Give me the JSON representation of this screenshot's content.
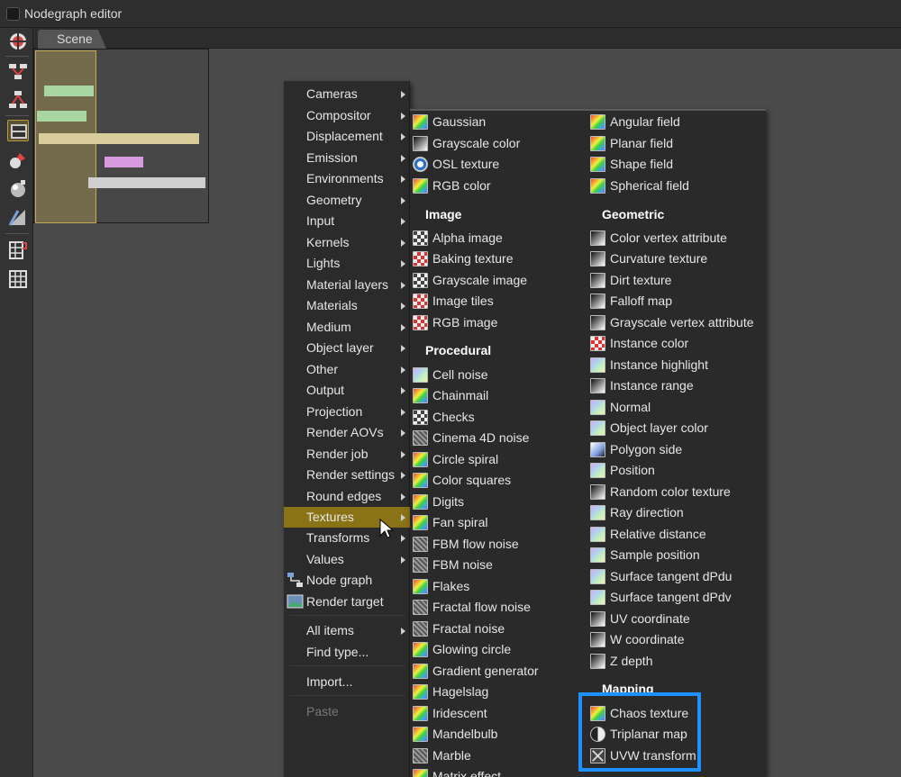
{
  "window": {
    "title": "Nodegraph editor"
  },
  "tabs": [
    {
      "label": "Scene"
    }
  ],
  "toolbar": {
    "tools": [
      {
        "icon": "scene-tool-icon"
      },
      {
        "icon": "nodes-up-icon"
      },
      {
        "icon": "nodes-down-icon"
      },
      {
        "icon": "image-tool-icon"
      },
      {
        "icon": "paint-tool-icon"
      },
      {
        "icon": "sphere-tool-icon"
      },
      {
        "icon": "texture-tool-icon"
      },
      {
        "icon": "grid-magnet-icon"
      },
      {
        "icon": "grid-icon"
      }
    ]
  },
  "context_menu": {
    "items": [
      {
        "label": "Cameras"
      },
      {
        "label": "Compositor"
      },
      {
        "label": "Displacement"
      },
      {
        "label": "Emission"
      },
      {
        "label": "Environments"
      },
      {
        "label": "Geometry"
      },
      {
        "label": "Input"
      },
      {
        "label": "Kernels"
      },
      {
        "label": "Lights"
      },
      {
        "label": "Material layers"
      },
      {
        "label": "Materials"
      },
      {
        "label": "Medium"
      },
      {
        "label": "Object layer"
      },
      {
        "label": "Other"
      },
      {
        "label": "Output"
      },
      {
        "label": "Projection"
      },
      {
        "label": "Render AOVs"
      },
      {
        "label": "Render job"
      },
      {
        "label": "Render settings"
      },
      {
        "label": "Round edges"
      },
      {
        "label": "Textures"
      },
      {
        "label": "Transforms"
      },
      {
        "label": "Values"
      },
      {
        "label": "Node graph"
      },
      {
        "label": "Render target"
      },
      {
        "label": "All items"
      },
      {
        "label": "Find type..."
      },
      {
        "label": "Import..."
      },
      {
        "label": "Paste"
      }
    ],
    "selected": "Textures"
  },
  "textures_submenu": {
    "col1_top": [
      "Gaussian",
      "Grayscale color",
      "OSL texture",
      "RGB color"
    ],
    "image_header": "Image",
    "image": [
      "Alpha image",
      "Baking texture",
      "Grayscale image",
      "Image tiles",
      "RGB image"
    ],
    "procedural_header": "Procedural",
    "procedural": [
      "Cell noise",
      "Chainmail",
      "Checks",
      "Cinema 4D noise",
      "Circle spiral",
      "Color squares",
      "Digits",
      "Fan spiral",
      "FBM flow noise",
      "FBM noise",
      "Flakes",
      "Fractal flow noise",
      "Fractal noise",
      "Glowing circle",
      "Gradient generator",
      "Hagelslag",
      "Iridescent",
      "Mandelbulb",
      "Marble",
      "Matrix effect"
    ],
    "col2_top": [
      "Angular field",
      "Planar field",
      "Shape field",
      "Spherical field"
    ],
    "geometric_header": "Geometric",
    "geometric": [
      "Color vertex attribute",
      "Curvature texture",
      "Dirt texture",
      "Falloff map",
      "Grayscale vertex attribute",
      "Instance color",
      "Instance highlight",
      "Instance range",
      "Normal",
      "Object layer color",
      "Polygon side",
      "Position",
      "Random color texture",
      "Ray direction",
      "Relative distance",
      "Sample position",
      "Surface tangent dPdu",
      "Surface tangent dPdv",
      "UV coordinate",
      "W coordinate",
      "Z depth"
    ],
    "mapping_header": "Mapping",
    "mapping": [
      "Chaos texture",
      "Triplanar map",
      "UVW transform"
    ]
  },
  "colors": {
    "selected_item": "#8a7316",
    "highlight_box": "#1e90ff",
    "menu_bg": "#2b2b2b"
  }
}
